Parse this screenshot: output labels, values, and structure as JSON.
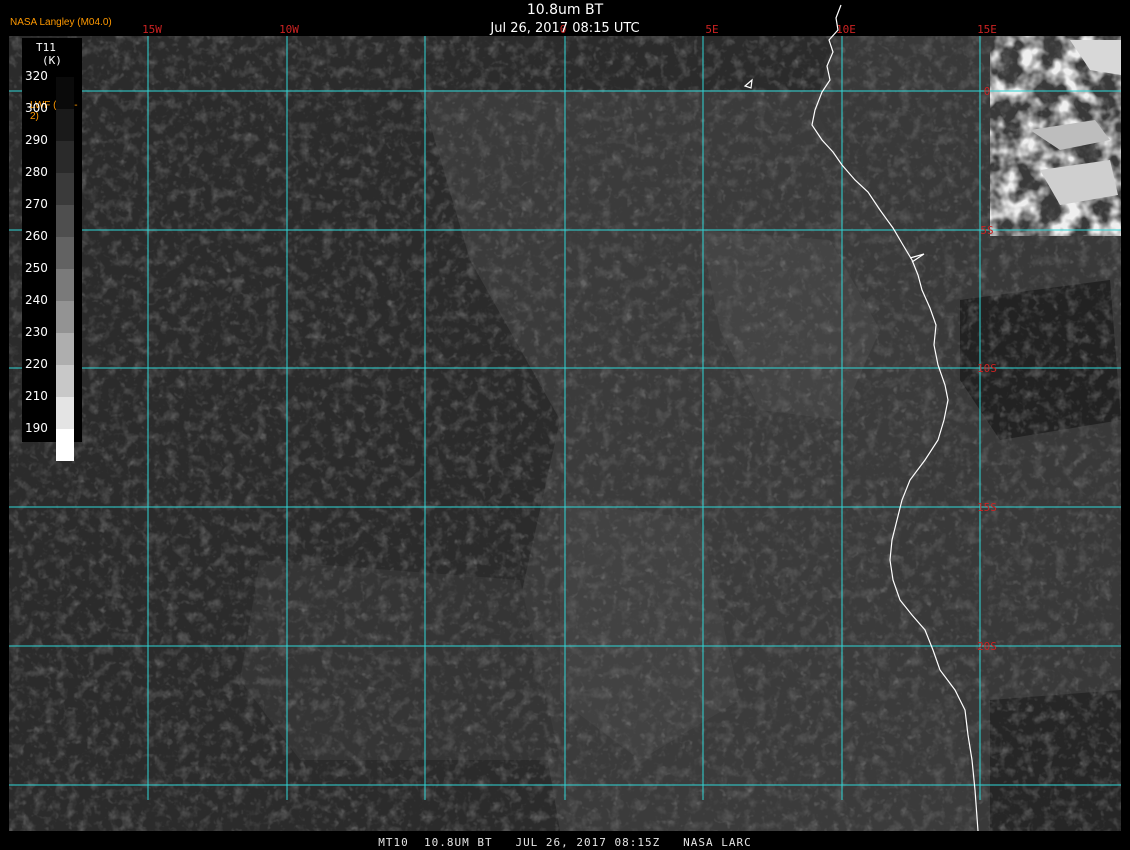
{
  "header": {
    "title": "10.8um BT",
    "datetime": "Jul 26, 2017 08:15 UTC",
    "brand": "NASA Langley (M04.0)"
  },
  "legend": {
    "variable": "T11",
    "unit": "(K)",
    "alt_label": "LWF (Wm-2)",
    "ticks": [
      "320",
      "300",
      "290",
      "280",
      "270",
      "260",
      "250",
      "240",
      "230",
      "220",
      "210",
      "190"
    ]
  },
  "grid": {
    "lon_labels": [
      "15W",
      "10W",
      "0",
      "5E",
      "10E",
      "15E"
    ],
    "lat_labels": [
      "0",
      "5S",
      "10S",
      "15S",
      "20S"
    ],
    "line_color": "#2fd6d6",
    "label_color": "#cc2222"
  },
  "footer": {
    "text": "MT10  10.8UM BT   JUL 26, 2017 08:15Z   NASA LARC"
  },
  "colors": {
    "coastline": "#ffffff",
    "ocean_cloud_dark": "#1c1c1c",
    "ocean_mid": "#333333",
    "clear_sky": "#444444",
    "cold_cloud": "#e8e8e8"
  }
}
